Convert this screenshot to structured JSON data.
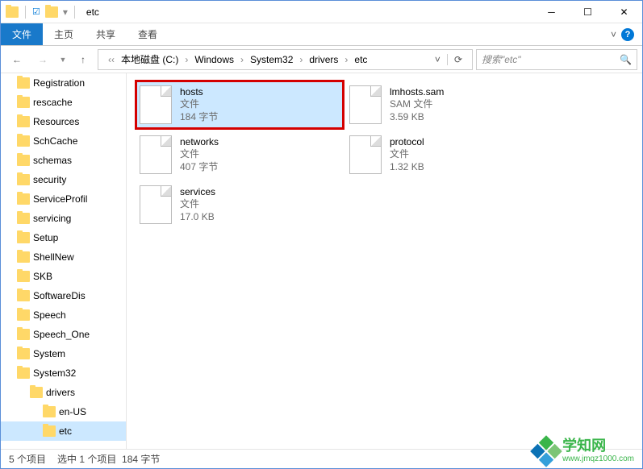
{
  "window": {
    "title": "etc"
  },
  "ribbon": {
    "file": "文件",
    "tabs": [
      "主页",
      "共享",
      "查看"
    ]
  },
  "breadcrumb": {
    "items": [
      {
        "label": "本地磁盘 (C:)"
      },
      {
        "label": "Windows"
      },
      {
        "label": "System32"
      },
      {
        "label": "drivers"
      },
      {
        "label": "etc"
      }
    ]
  },
  "search": {
    "placeholder": "搜索\"etc\""
  },
  "sidebar": {
    "items": [
      {
        "label": "Registration",
        "level": 1
      },
      {
        "label": "rescache",
        "level": 1
      },
      {
        "label": "Resources",
        "level": 1
      },
      {
        "label": "SchCache",
        "level": 1
      },
      {
        "label": "schemas",
        "level": 1
      },
      {
        "label": "security",
        "level": 1
      },
      {
        "label": "ServiceProfil",
        "level": 1
      },
      {
        "label": "servicing",
        "level": 1
      },
      {
        "label": "Setup",
        "level": 1
      },
      {
        "label": "ShellNew",
        "level": 1
      },
      {
        "label": "SKB",
        "level": 1
      },
      {
        "label": "SoftwareDis",
        "level": 1
      },
      {
        "label": "Speech",
        "level": 1
      },
      {
        "label": "Speech_One",
        "level": 1
      },
      {
        "label": "System",
        "level": 1
      },
      {
        "label": "System32",
        "level": 1
      },
      {
        "label": "drivers",
        "level": 2
      },
      {
        "label": "en-US",
        "level": 3
      },
      {
        "label": "etc",
        "level": 3,
        "selected": true
      }
    ]
  },
  "files": [
    {
      "name": "hosts",
      "type": "文件",
      "size": "184 字节",
      "selected": true,
      "highlighted": true
    },
    {
      "name": "lmhosts.sam",
      "type": "SAM 文件",
      "size": "3.59 KB"
    },
    {
      "name": "networks",
      "type": "文件",
      "size": "407 字节"
    },
    {
      "name": "protocol",
      "type": "文件",
      "size": "1.32 KB"
    },
    {
      "name": "services",
      "type": "文件",
      "size": "17.0 KB"
    }
  ],
  "status": {
    "count": "5 个项目",
    "selection": "选中 1 个项目",
    "size": "184 字节"
  },
  "watermark": {
    "title": "学知网",
    "url": "www.jmqz1000.com"
  }
}
